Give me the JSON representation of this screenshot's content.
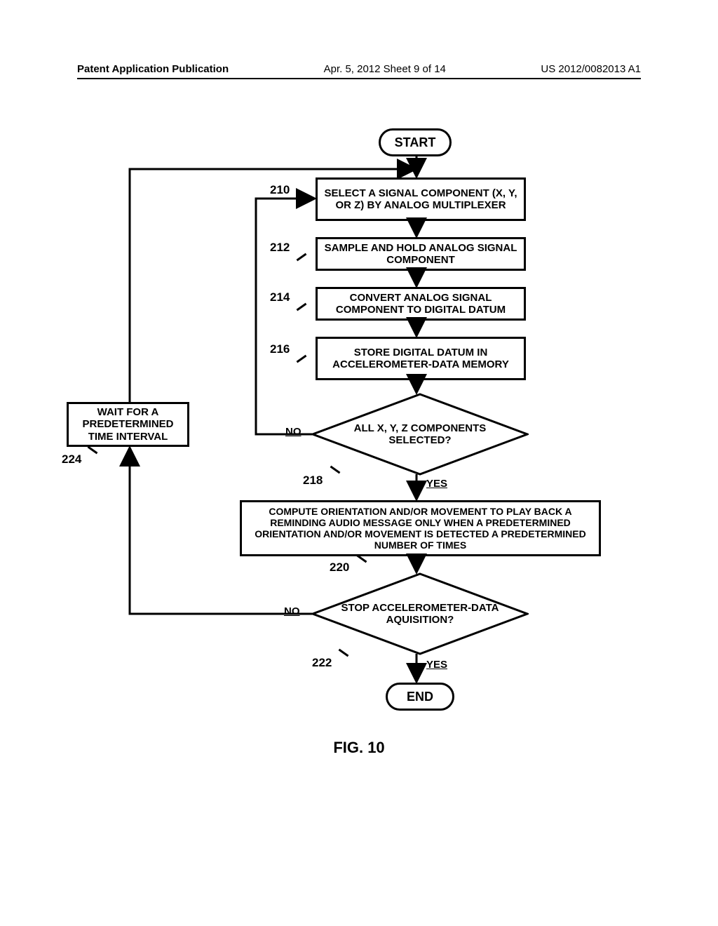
{
  "header": {
    "left": "Patent Application Publication",
    "middle": "Apr. 5, 2012  Sheet 9 of 14",
    "right": "US 2012/0082013 A1"
  },
  "nodes": {
    "start": "START",
    "end": "END",
    "b210": "SELECT A SIGNAL COMPONENT (X, Y, OR Z) BY ANALOG MULTIPLEXER",
    "b212": "SAMPLE AND HOLD ANALOG SIGNAL COMPONENT",
    "b214": "CONVERT ANALOG SIGNAL COMPONENT TO DIGITAL DATUM",
    "b216": "STORE DIGITAL DATUM IN ACCELEROMETER-DATA MEMORY",
    "d218": "ALL X, Y, Z COMPONENTS SELECTED?",
    "b220": "COMPUTE ORIENTATION AND/OR MOVEMENT TO PLAY BACK A REMINDING AUDIO MESSAGE ONLY WHEN A PREDETERMINED ORIENTATION AND/OR MOVEMENT IS DETECTED A PREDETERMINED NUMBER OF TIMES",
    "d222": "STOP ACCELEROMETER-DATA AQUISITION?",
    "b224": "WAIT FOR A PREDETERMINED TIME INTERVAL"
  },
  "refs": {
    "r210": "210",
    "r212": "212",
    "r214": "214",
    "r216": "216",
    "r218": "218",
    "r220": "220",
    "r222": "222",
    "r224": "224"
  },
  "labels": {
    "no": "NO",
    "yes": "YES"
  },
  "figure_caption": "FIG. 10"
}
